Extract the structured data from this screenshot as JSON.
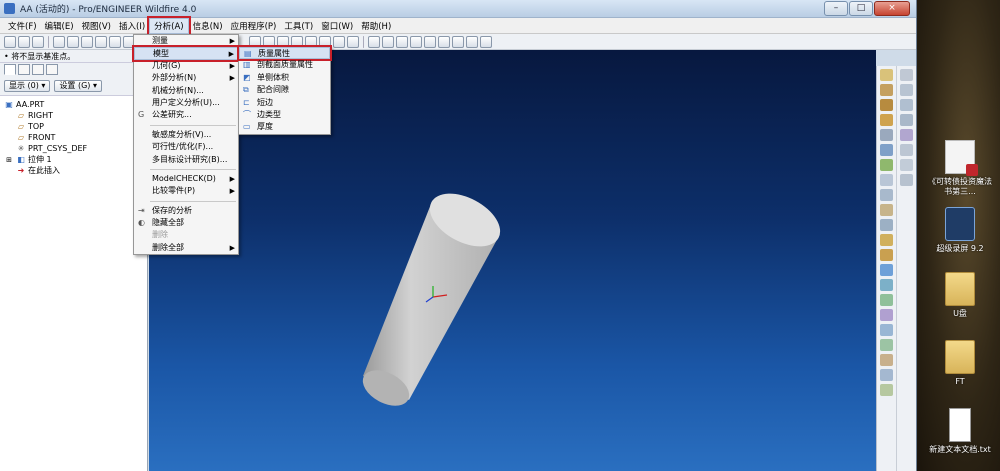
{
  "window": {
    "title": "AA (活动的) - Pro/ENGINEER Wildfire 4.0",
    "controls": [
      "–",
      "□",
      "×"
    ]
  },
  "menubar": [
    "文件(F)",
    "编辑(E)",
    "视图(V)",
    "插入(I)",
    "分析(A)",
    "信息(N)",
    "应用程序(P)",
    "工具(T)",
    "窗口(W)",
    "帮助(H)"
  ],
  "status_text": "• 将不显示基准点。",
  "panel_buttons": {
    "show": "显示 (0) ▾",
    "settings": "设置 (G) ▾"
  },
  "model_tree": [
    {
      "label": "AA.PRT",
      "icon": "part-icon",
      "indent": 0
    },
    {
      "label": "RIGHT",
      "icon": "datum-plane-icon",
      "indent": 1
    },
    {
      "label": "TOP",
      "icon": "datum-plane-icon",
      "indent": 1
    },
    {
      "label": "FRONT",
      "icon": "datum-plane-icon",
      "indent": 1
    },
    {
      "label": "PRT_CSYS_DEF",
      "icon": "csys-icon",
      "indent": 1
    },
    {
      "label": "拉伸 1",
      "icon": "extrude-icon",
      "indent": 0
    },
    {
      "label": "在此插入",
      "icon": "insert-arrow-icon",
      "indent": 1
    }
  ],
  "analysis_menu": [
    {
      "label": "测量",
      "arrow": true
    },
    {
      "label": "模型",
      "arrow": true,
      "highlight": true
    },
    {
      "label": "几何(G)",
      "arrow": true
    },
    {
      "label": "外部分析(N)",
      "arrow": true
    },
    {
      "label": "机械分析(N)...",
      "arrow": false
    },
    {
      "label": "用户定义分析(U)...",
      "arrow": false
    },
    {
      "label": "公差研究...",
      "arrow": false,
      "lead": "G"
    },
    {
      "sep": true
    },
    {
      "label": "敏感度分析(V)...",
      "arrow": false
    },
    {
      "label": "可行性/优化(F)...",
      "arrow": false
    },
    {
      "label": "多目标设计研究(B)...",
      "arrow": false
    },
    {
      "sep": true
    },
    {
      "label": "ModelCHECK(D)",
      "arrow": true
    },
    {
      "label": "比较零件(P)",
      "arrow": true
    },
    {
      "sep": true
    },
    {
      "label": "保存的分析",
      "arrow": false
    },
    {
      "label": "隐藏全部",
      "arrow": false
    },
    {
      "label": "删除",
      "arrow": false,
      "disabled": true
    },
    {
      "label": "删除全部",
      "arrow": true
    }
  ],
  "model_submenu": [
    {
      "label": "质量属性",
      "highlight": true
    },
    {
      "label": "剖截面质量属性"
    },
    {
      "label": "单侧体积"
    },
    {
      "label": "配合间隙"
    },
    {
      "label": "短边"
    },
    {
      "label": "边类型"
    },
    {
      "label": "厚度"
    }
  ],
  "desktop_icons": [
    {
      "label": "《可转债投资魔法书第三...",
      "icon": "pdf-icon"
    },
    {
      "label": "超级录屏 9.2",
      "icon": "video-app-icon"
    },
    {
      "label": "U盘",
      "icon": "folder-icon"
    },
    {
      "label": "FT",
      "icon": "folder-icon"
    },
    {
      "label": "新建文本文档.txt",
      "icon": "text-file-icon"
    }
  ],
  "colors": {
    "highlight_red": "#c8202a",
    "graphics_top": "#07183f",
    "graphics_bottom": "#2a6fc0",
    "cylinder": "#c9c9c9"
  }
}
